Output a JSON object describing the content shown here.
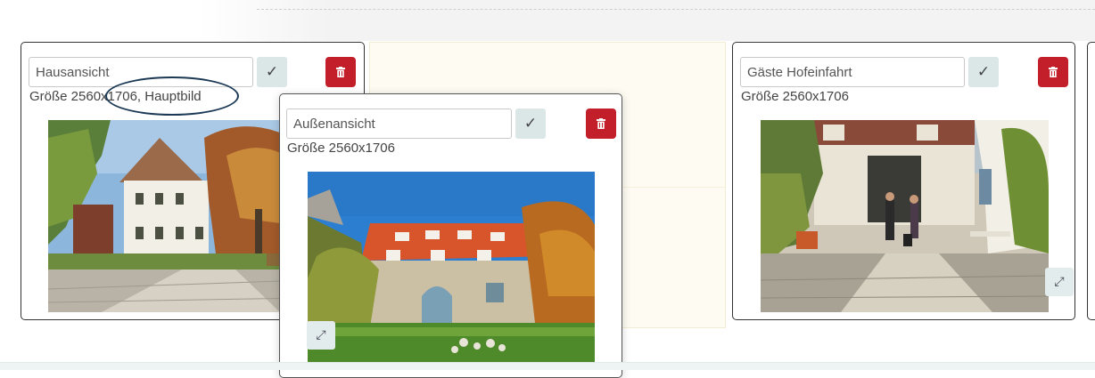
{
  "cards": [
    {
      "title_value": "Hausansicht",
      "size_label": "Größe 2560x1706, Hauptbild",
      "confirm_symbol": "✓",
      "expand_symbol": "⤢",
      "photo": "courtyard-house-photo"
    },
    {
      "title_value": "Außenansicht",
      "size_label": "Größe 2560x1706",
      "confirm_symbol": "✓",
      "expand_symbol": "⤢",
      "photo": "barn-exterior-photo",
      "dragging": true
    },
    {
      "title_value": "Gäste Hofeinfahrt",
      "size_label": "Größe 2560x1706",
      "confirm_symbol": "✓",
      "expand_symbol": "⤢",
      "photo": "guests-courtyard-photo"
    }
  ],
  "icons": {
    "delete": "trash-icon",
    "confirm": "check-icon",
    "expand": "expand-icon"
  },
  "colors": {
    "delete_button": "#c21f2b",
    "confirm_button": "#dbe6e6",
    "drop_placeholder": "#fefcf2",
    "highlight_ring": "#1c3a55"
  }
}
